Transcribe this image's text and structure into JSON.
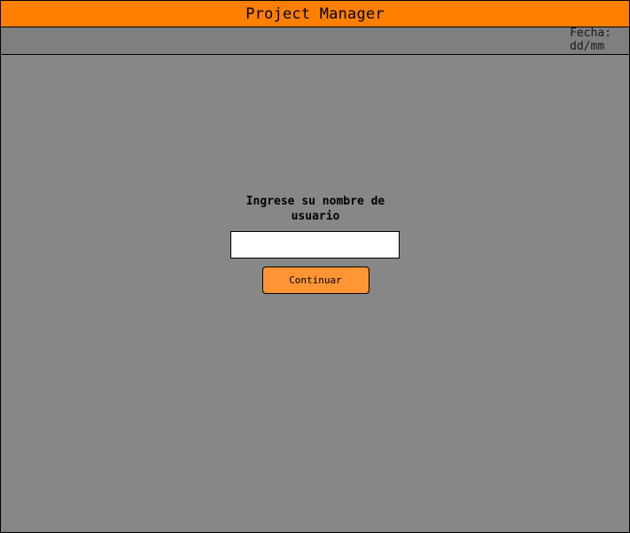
{
  "header": {
    "title": "Project Manager"
  },
  "subheader": {
    "date_label": "Fecha:",
    "date_value": "dd/mm"
  },
  "login": {
    "prompt": "Ingrese su nombre de usuario",
    "username_value": "",
    "continue_label": "Continuar"
  },
  "colors": {
    "accent": "#ff8000",
    "button": "#ff9533",
    "background": "#878787"
  }
}
